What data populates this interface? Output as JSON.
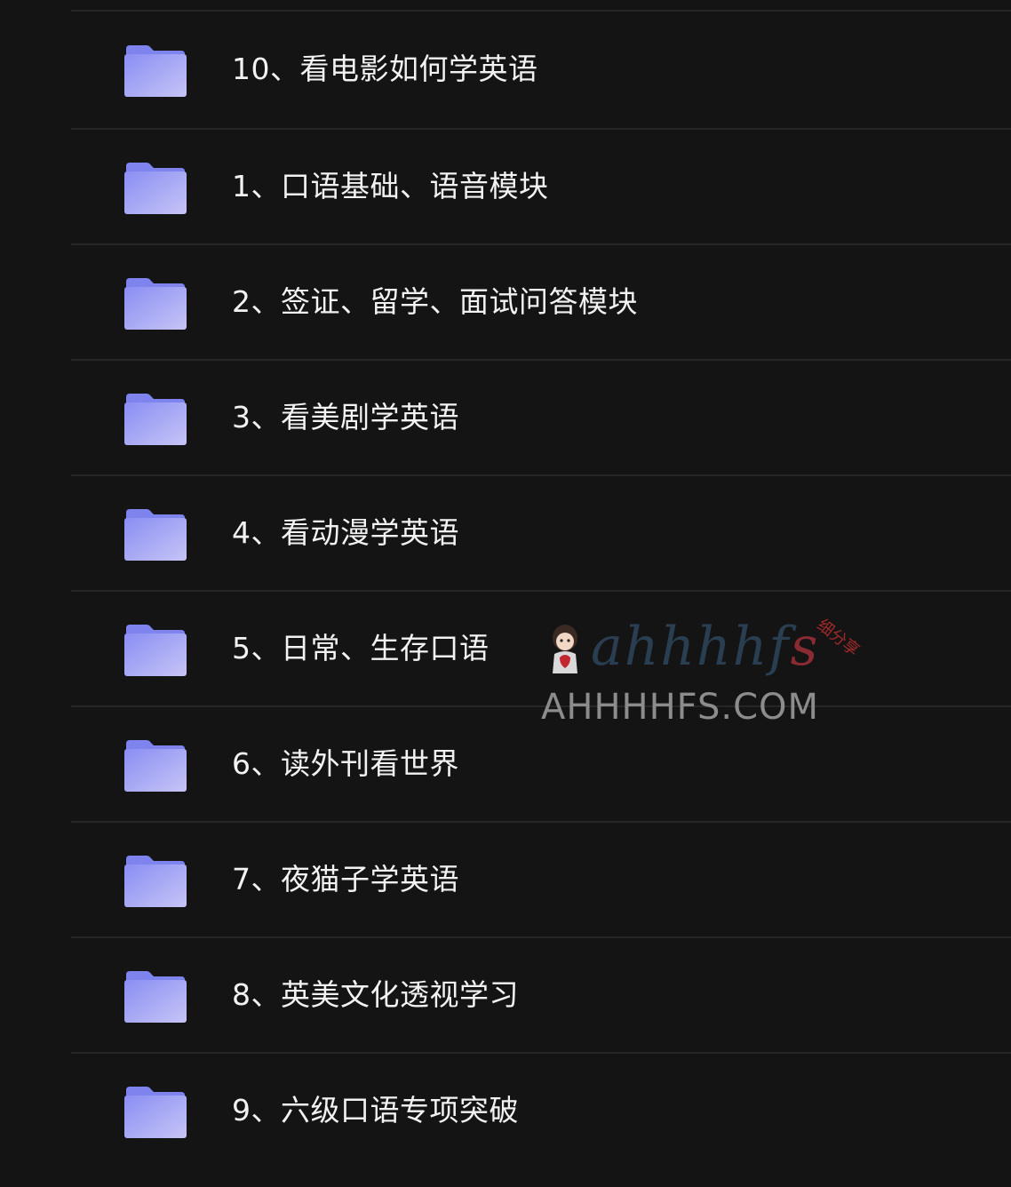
{
  "folders": [
    {
      "name": "10、看电影如何学英语",
      "icon": "folder-icon"
    },
    {
      "name": "1、口语基础、语音模块",
      "icon": "folder-icon"
    },
    {
      "name": "2、签证、留学、面试问答模块",
      "icon": "folder-icon"
    },
    {
      "name": "3、看美剧学英语",
      "icon": "folder-icon"
    },
    {
      "name": "4、看动漫学英语",
      "icon": "folder-icon"
    },
    {
      "name": "5、日常、生存口语",
      "icon": "folder-icon"
    },
    {
      "name": "6、读外刊看世界",
      "icon": "folder-icon"
    },
    {
      "name": "7、夜猫子学英语",
      "icon": "folder-icon"
    },
    {
      "name": "8、英美文化透视学习",
      "icon": "folder-icon"
    },
    {
      "name": "9、六级口语专项突破",
      "icon": "folder-icon"
    }
  ],
  "watermark": {
    "logo_main": "ahhhhf",
    "logo_accent": "s",
    "tag": "细分享",
    "url": "AHHHHFS.COM"
  },
  "colors": {
    "background": "#141414",
    "divider": "#262626",
    "text": "#f2f2f2",
    "folder_light": "#b7b8f7",
    "folder_dark": "#8a8ef2"
  }
}
